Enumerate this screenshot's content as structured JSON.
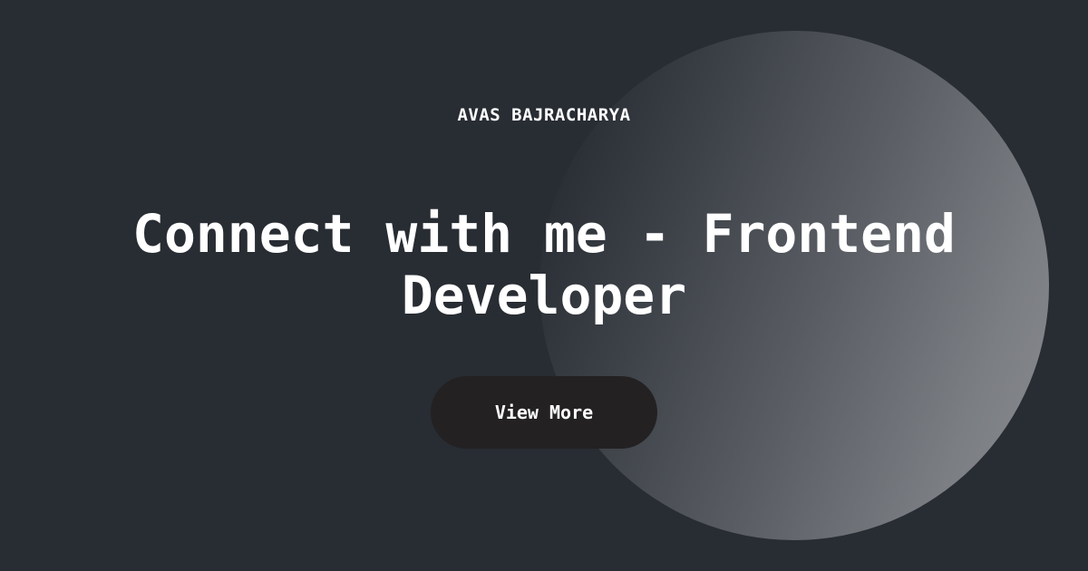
{
  "header": {
    "author": "AVAS BAJRACHARYA"
  },
  "main": {
    "headline": "Connect with me - Frontend Developer",
    "cta_label": "View More"
  },
  "colors": {
    "background": "#282c33",
    "button": "#232122",
    "text": "#ffffff",
    "circle_highlight": "#8a8c90"
  }
}
